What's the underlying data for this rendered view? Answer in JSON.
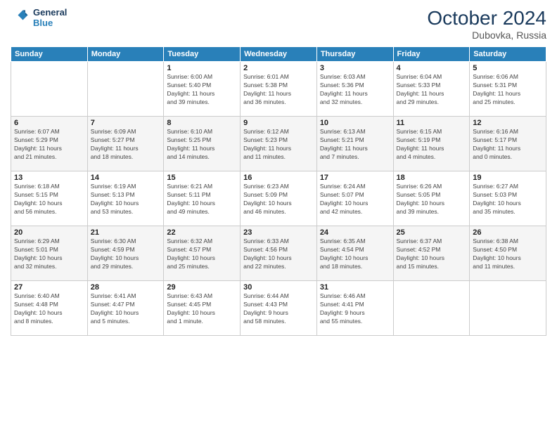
{
  "header": {
    "logo_line1": "General",
    "logo_line2": "Blue",
    "month": "October 2024",
    "location": "Dubovka, Russia"
  },
  "columns": [
    "Sunday",
    "Monday",
    "Tuesday",
    "Wednesday",
    "Thursday",
    "Friday",
    "Saturday"
  ],
  "weeks": [
    [
      {
        "day": "",
        "info": ""
      },
      {
        "day": "",
        "info": ""
      },
      {
        "day": "1",
        "info": "Sunrise: 6:00 AM\nSunset: 5:40 PM\nDaylight: 11 hours\nand 39 minutes."
      },
      {
        "day": "2",
        "info": "Sunrise: 6:01 AM\nSunset: 5:38 PM\nDaylight: 11 hours\nand 36 minutes."
      },
      {
        "day": "3",
        "info": "Sunrise: 6:03 AM\nSunset: 5:36 PM\nDaylight: 11 hours\nand 32 minutes."
      },
      {
        "day": "4",
        "info": "Sunrise: 6:04 AM\nSunset: 5:33 PM\nDaylight: 11 hours\nand 29 minutes."
      },
      {
        "day": "5",
        "info": "Sunrise: 6:06 AM\nSunset: 5:31 PM\nDaylight: 11 hours\nand 25 minutes."
      }
    ],
    [
      {
        "day": "6",
        "info": "Sunrise: 6:07 AM\nSunset: 5:29 PM\nDaylight: 11 hours\nand 21 minutes."
      },
      {
        "day": "7",
        "info": "Sunrise: 6:09 AM\nSunset: 5:27 PM\nDaylight: 11 hours\nand 18 minutes."
      },
      {
        "day": "8",
        "info": "Sunrise: 6:10 AM\nSunset: 5:25 PM\nDaylight: 11 hours\nand 14 minutes."
      },
      {
        "day": "9",
        "info": "Sunrise: 6:12 AM\nSunset: 5:23 PM\nDaylight: 11 hours\nand 11 minutes."
      },
      {
        "day": "10",
        "info": "Sunrise: 6:13 AM\nSunset: 5:21 PM\nDaylight: 11 hours\nand 7 minutes."
      },
      {
        "day": "11",
        "info": "Sunrise: 6:15 AM\nSunset: 5:19 PM\nDaylight: 11 hours\nand 4 minutes."
      },
      {
        "day": "12",
        "info": "Sunrise: 6:16 AM\nSunset: 5:17 PM\nDaylight: 11 hours\nand 0 minutes."
      }
    ],
    [
      {
        "day": "13",
        "info": "Sunrise: 6:18 AM\nSunset: 5:15 PM\nDaylight: 10 hours\nand 56 minutes."
      },
      {
        "day": "14",
        "info": "Sunrise: 6:19 AM\nSunset: 5:13 PM\nDaylight: 10 hours\nand 53 minutes."
      },
      {
        "day": "15",
        "info": "Sunrise: 6:21 AM\nSunset: 5:11 PM\nDaylight: 10 hours\nand 49 minutes."
      },
      {
        "day": "16",
        "info": "Sunrise: 6:23 AM\nSunset: 5:09 PM\nDaylight: 10 hours\nand 46 minutes."
      },
      {
        "day": "17",
        "info": "Sunrise: 6:24 AM\nSunset: 5:07 PM\nDaylight: 10 hours\nand 42 minutes."
      },
      {
        "day": "18",
        "info": "Sunrise: 6:26 AM\nSunset: 5:05 PM\nDaylight: 10 hours\nand 39 minutes."
      },
      {
        "day": "19",
        "info": "Sunrise: 6:27 AM\nSunset: 5:03 PM\nDaylight: 10 hours\nand 35 minutes."
      }
    ],
    [
      {
        "day": "20",
        "info": "Sunrise: 6:29 AM\nSunset: 5:01 PM\nDaylight: 10 hours\nand 32 minutes."
      },
      {
        "day": "21",
        "info": "Sunrise: 6:30 AM\nSunset: 4:59 PM\nDaylight: 10 hours\nand 29 minutes."
      },
      {
        "day": "22",
        "info": "Sunrise: 6:32 AM\nSunset: 4:57 PM\nDaylight: 10 hours\nand 25 minutes."
      },
      {
        "day": "23",
        "info": "Sunrise: 6:33 AM\nSunset: 4:56 PM\nDaylight: 10 hours\nand 22 minutes."
      },
      {
        "day": "24",
        "info": "Sunrise: 6:35 AM\nSunset: 4:54 PM\nDaylight: 10 hours\nand 18 minutes."
      },
      {
        "day": "25",
        "info": "Sunrise: 6:37 AM\nSunset: 4:52 PM\nDaylight: 10 hours\nand 15 minutes."
      },
      {
        "day": "26",
        "info": "Sunrise: 6:38 AM\nSunset: 4:50 PM\nDaylight: 10 hours\nand 11 minutes."
      }
    ],
    [
      {
        "day": "27",
        "info": "Sunrise: 6:40 AM\nSunset: 4:48 PM\nDaylight: 10 hours\nand 8 minutes."
      },
      {
        "day": "28",
        "info": "Sunrise: 6:41 AM\nSunset: 4:47 PM\nDaylight: 10 hours\nand 5 minutes."
      },
      {
        "day": "29",
        "info": "Sunrise: 6:43 AM\nSunset: 4:45 PM\nDaylight: 10 hours\nand 1 minute."
      },
      {
        "day": "30",
        "info": "Sunrise: 6:44 AM\nSunset: 4:43 PM\nDaylight: 9 hours\nand 58 minutes."
      },
      {
        "day": "31",
        "info": "Sunrise: 6:46 AM\nSunset: 4:41 PM\nDaylight: 9 hours\nand 55 minutes."
      },
      {
        "day": "",
        "info": ""
      },
      {
        "day": "",
        "info": ""
      }
    ]
  ]
}
